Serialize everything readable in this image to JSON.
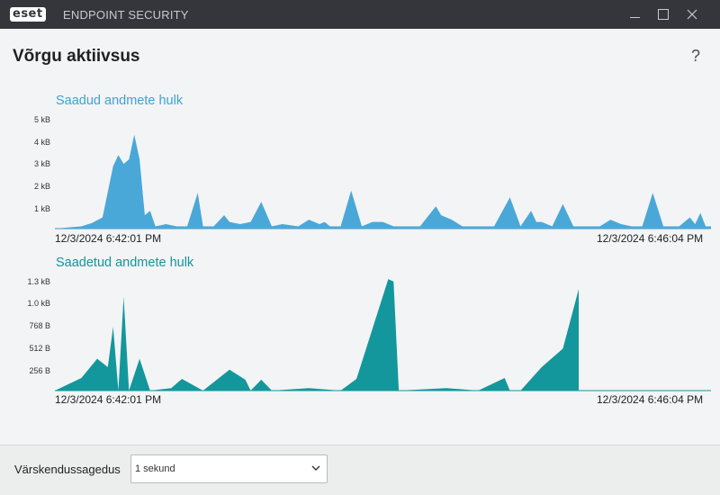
{
  "titlebar": {
    "logo_text": "eset",
    "product": "ENDPOINT SECURITY",
    "buttons": [
      "minimize",
      "maximize",
      "close"
    ]
  },
  "page": {
    "title": "Võrgu aktiivsus",
    "help_label": "?"
  },
  "charts": {
    "received": {
      "title": "Saadud andmete hulk",
      "y_ticks": [
        "5 kB",
        "4 kB",
        "3 kB",
        "2 kB",
        "1 kB"
      ],
      "start_time": "12/3/2024 6:42:01 PM",
      "end_time": "12/3/2024 6:46:04 PM",
      "color": "#4aa8d8"
    },
    "sent": {
      "title": "Saadetud andmete hulk",
      "y_ticks": [
        "1.3 kB",
        "1.0 kB",
        "768 B",
        "512 B",
        "256 B"
      ],
      "start_time": "12/3/2024 6:42:01 PM",
      "end_time": "12/3/2024 6:46:04 PM",
      "color": "#13979c"
    }
  },
  "chart_data": [
    {
      "type": "area",
      "title": "Saadud andmete hulk",
      "ylabel": "",
      "y_ticks": [
        "5 kB",
        "4 kB",
        "3 kB",
        "2 kB",
        "1 kB"
      ],
      "ylim_kB": [
        0,
        5
      ],
      "x_range": [
        "12/3/2024 6:42:01 PM",
        "12/3/2024 6:46:04 PM"
      ],
      "grid": false,
      "series": [
        {
          "points_kB": [
            [
              0,
              0
            ],
            [
              5,
              0.1
            ],
            [
              7,
              0.25
            ],
            [
              9,
              0.5
            ],
            [
              11,
              2.8
            ],
            [
              12,
              3.3
            ],
            [
              13,
              2.9
            ],
            [
              14,
              3.1
            ],
            [
              15,
              4.2
            ],
            [
              16,
              3.1
            ],
            [
              17,
              0.6
            ],
            [
              18,
              0.8
            ],
            [
              19,
              0.1
            ],
            [
              21,
              0.2
            ],
            [
              23,
              0.1
            ],
            [
              25,
              0.1
            ],
            [
              27,
              1.6
            ],
            [
              28,
              0.1
            ],
            [
              30,
              0.1
            ],
            [
              32,
              0.6
            ],
            [
              33,
              0.3
            ],
            [
              35,
              0.2
            ],
            [
              37,
              0.3
            ],
            [
              39,
              1.2
            ],
            [
              41,
              0.1
            ],
            [
              43,
              0.2
            ],
            [
              46,
              0.1
            ],
            [
              48,
              0.4
            ],
            [
              50,
              0.2
            ],
            [
              51,
              0.3
            ],
            [
              52,
              0.1
            ],
            [
              54,
              0.1
            ],
            [
              56,
              1.7
            ],
            [
              58,
              0.1
            ],
            [
              60,
              0.3
            ],
            [
              62,
              0.3
            ],
            [
              64,
              0.1
            ],
            [
              66,
              0.1
            ],
            [
              69,
              0.1
            ],
            [
              72,
              1
            ],
            [
              73,
              0.6
            ],
            [
              75,
              0.4
            ],
            [
              77,
              0.1
            ],
            [
              80,
              0.1
            ],
            [
              83,
              0.1
            ],
            [
              86,
              1.4
            ],
            [
              88,
              0.1
            ],
            [
              90,
              0.8
            ],
            [
              91,
              0.3
            ],
            [
              92,
              0.3
            ],
            [
              94,
              0.1
            ],
            [
              96,
              1.1
            ],
            [
              98,
              0.1
            ],
            [
              100,
              0.1
            ],
            [
              103,
              0.1
            ],
            [
              105,
              0.4
            ],
            [
              107,
              0.2
            ],
            [
              109,
              0.1
            ],
            [
              111,
              0.1
            ],
            [
              113,
              1.6
            ],
            [
              115,
              0.1
            ],
            [
              118,
              0.1
            ],
            [
              120,
              0.5
            ],
            [
              121,
              0.2
            ],
            [
              122,
              0.7
            ],
            [
              123,
              0.1
            ],
            [
              124,
              0.1
            ]
          ]
        }
      ]
    },
    {
      "type": "area",
      "title": "Saadetud andmete hulk",
      "ylabel": "",
      "y_ticks": [
        "1.3 kB",
        "1.0 kB",
        "768 B",
        "512 B",
        "256 B"
      ],
      "ylim_B": [
        0,
        1331
      ],
      "x_range": [
        "12/3/2024 6:42:01 PM",
        "12/3/2024 6:46:04 PM"
      ],
      "grid": false,
      "series": [
        {
          "points_B": [
            [
              0,
              0
            ],
            [
              5,
              150
            ],
            [
              8,
              380
            ],
            [
              10,
              280
            ],
            [
              11,
              760
            ],
            [
              12,
              0
            ],
            [
              13,
              1120
            ],
            [
              14,
              0
            ],
            [
              16,
              380
            ],
            [
              18,
              0
            ],
            [
              22,
              30
            ],
            [
              24,
              140
            ],
            [
              28,
              0
            ],
            [
              33,
              250
            ],
            [
              36,
              130
            ],
            [
              37,
              0
            ],
            [
              39,
              130
            ],
            [
              41,
              0
            ],
            [
              48,
              30
            ],
            [
              54,
              0
            ],
            [
              57,
              140
            ],
            [
              63,
              1330
            ],
            [
              64,
              1300
            ],
            [
              65,
              0
            ],
            [
              74,
              30
            ],
            [
              80,
              0
            ],
            [
              85,
              150
            ],
            [
              86,
              0
            ],
            [
              88,
              0
            ],
            [
              92,
              280
            ],
            [
              96,
              500
            ],
            [
              99,
              1210
            ]
          ]
        }
      ]
    }
  ],
  "footer": {
    "refresh_label": "Värskendussagedus",
    "refresh_value": "1 sekund"
  }
}
